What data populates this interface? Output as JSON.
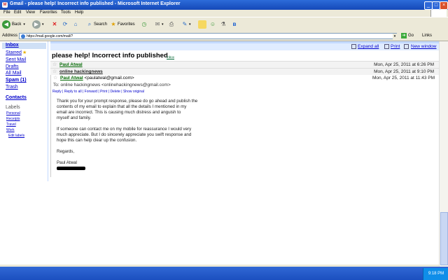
{
  "window": {
    "title": "Gmail - please help! Incorrect info published - Microsoft Internet Explorer"
  },
  "menu": [
    "File",
    "Edit",
    "View",
    "Favorites",
    "Tools",
    "Help"
  ],
  "toolbar": {
    "back": "Back",
    "search": "Search",
    "favorites": "Favorites"
  },
  "address": {
    "label": "Address",
    "url": "https://mail.google.com/mail/?",
    "go": "Go",
    "links": "Links"
  },
  "sidebar": {
    "inbox": "Inbox",
    "starred": "Starred",
    "sent": "Sent Mail",
    "drafts": "Drafts",
    "all": "All Mail",
    "spam": "Spam (1)",
    "trash": "Trash",
    "contacts": "Contacts",
    "labels_heading": "Labels",
    "labels": [
      "Personal",
      "Receipts",
      "Travel",
      "Work"
    ],
    "edit_labels": "Edit labels"
  },
  "toolbar_links": {
    "expand_all": "Expand all",
    "print": "Print",
    "new_window": "New window"
  },
  "thread": {
    "subject": "please help! Incorrect info published",
    "label": "Inbox",
    "messages": [
      {
        "sender": "Paul Atwal",
        "date": "Mon, Apr 25, 2011 at 6:26 PM"
      },
      {
        "sender": "online hackingnews",
        "date": "Mon, Apr 25, 2011 at 9:10 PM"
      },
      {
        "sender": "Paul Atwal",
        "email": "<paulatwal@gmail.com>",
        "date": "Mon, Apr 25, 2011 at 11:43 PM"
      }
    ],
    "to": "To: online hackingnews <onlinehackingnews@gmail.com>",
    "actions": "Reply | Reply to all | Forward | Print | Delete | Show original",
    "body": [
      "Thank you for your prompt response, please do go ahead and publish the",
      "contents of my email to explain that all the details I mentioned in my",
      "email are incorrect. This is causing much distress and anguish to",
      "myself and family.",
      "If someone can contact me on my mobile for reassurance I would very",
      "much appreciate. But I do sincerely appreciate you swift response and",
      "hope this can help clear up the confusion.",
      "Regards,",
      "Paul Atwal"
    ]
  },
  "taskbar": {
    "clock": "9:18 PM"
  }
}
